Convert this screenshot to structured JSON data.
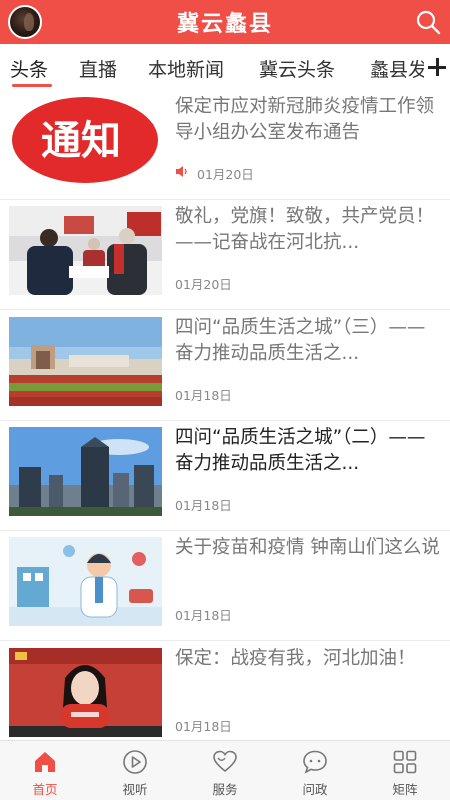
{
  "header": {
    "title": "冀云蠡县",
    "avatar_icon": "user-avatar",
    "search_icon": "search-icon",
    "brand_color": "#ef4f47"
  },
  "tabs": {
    "items": [
      {
        "label": "头条",
        "active": true
      },
      {
        "label": "直播"
      },
      {
        "label": "本地新闻"
      },
      {
        "label": "冀云头条"
      },
      {
        "label": "蠡县发"
      }
    ],
    "add_icon": "plus-icon"
  },
  "news": [
    {
      "title": "保定市应对新冠肺炎疫情工作领导小组办公室发布通告",
      "date": "01月20日",
      "audio": true,
      "thumb_text": "通知"
    },
    {
      "title": "敬礼，党旗！致敬，共产党员！——记奋战在河北抗...",
      "date": "01月20日"
    },
    {
      "title": "四问“品质生活之城”（三）——奋力推动品质生活之...",
      "date": "01月18日"
    },
    {
      "title": "四问“品质生活之城”（二）——奋力推动品质生活之...",
      "date": "01月18日",
      "dark": true
    },
    {
      "title": "关于疫苗和疫情 钟南山们这么说",
      "date": "01月18日"
    },
    {
      "title": "保定：战疫有我，河北加油！",
      "date": "01月18日"
    }
  ],
  "tabbar": [
    {
      "label": "首页",
      "icon": "home-icon",
      "active": true
    },
    {
      "label": "视听",
      "icon": "play-icon"
    },
    {
      "label": "服务",
      "icon": "heart-icon"
    },
    {
      "label": "问政",
      "icon": "chat-icon"
    },
    {
      "label": "矩阵",
      "icon": "grid-icon"
    }
  ]
}
